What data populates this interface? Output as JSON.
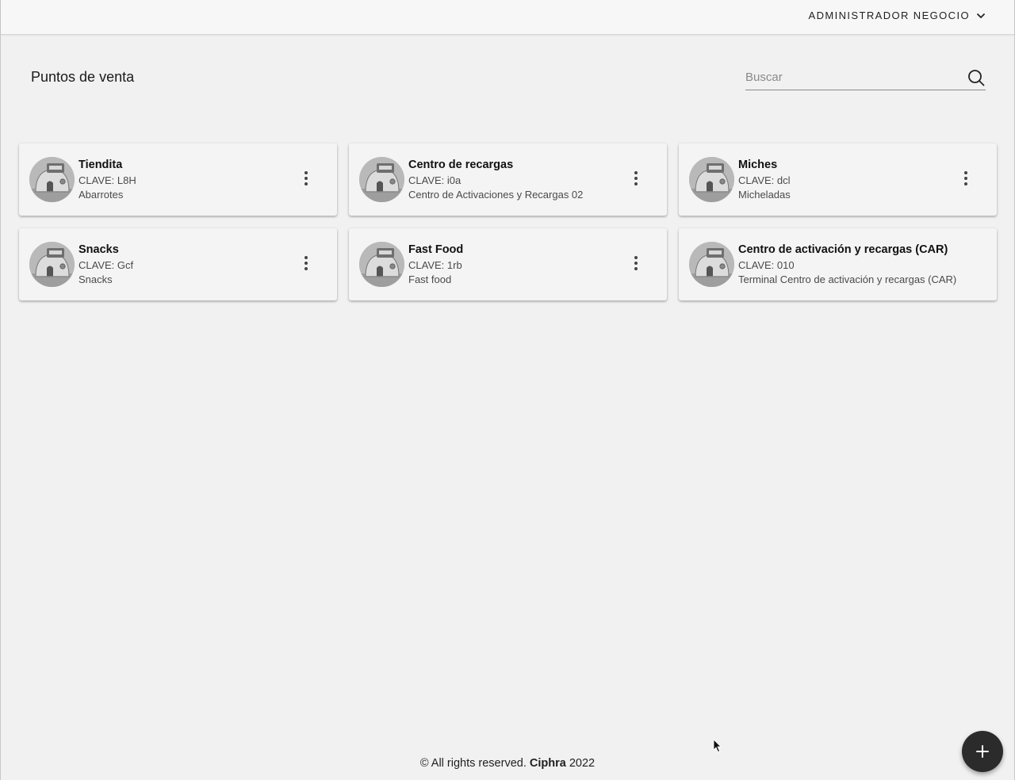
{
  "header": {
    "user_menu_label": "ADMINISTRADOR NEGOCIO",
    "user_menu_icon": "chevron-down-icon"
  },
  "page": {
    "title": "Puntos de venta"
  },
  "search": {
    "placeholder": "Buscar",
    "value": "",
    "icon": "search-icon"
  },
  "stores": [
    {
      "name": "Tiendita",
      "clave": "CLAVE: L8H",
      "description": "Abarrotes",
      "has_menu": true
    },
    {
      "name": "Centro de recargas",
      "clave": "CLAVE: i0a",
      "description": "Centro de Activaciones y Recargas 02",
      "has_menu": true
    },
    {
      "name": "Miches",
      "clave": "CLAVE: dcl",
      "description": "Micheladas",
      "has_menu": true
    },
    {
      "name": "Snacks",
      "clave": "CLAVE: Gcf",
      "description": "Snacks",
      "has_menu": true
    },
    {
      "name": "Fast Food",
      "clave": "CLAVE: 1rb",
      "description": "Fast food",
      "has_menu": true
    },
    {
      "name": "Centro de activación y recargas (CAR)",
      "clave": "CLAVE: 010",
      "description": "Terminal Centro de activación y recargas (CAR)",
      "has_menu": false
    }
  ],
  "footer": {
    "prefix": "© All rights reserved.",
    "brand": "Ciphra",
    "year": "2022"
  },
  "fab": {
    "icon": "plus-icon"
  },
  "colors": {
    "background": "#f1f1f1",
    "card": "#f4f4f4",
    "fab": "#2b2b2b",
    "text": "#1a1a1a"
  }
}
